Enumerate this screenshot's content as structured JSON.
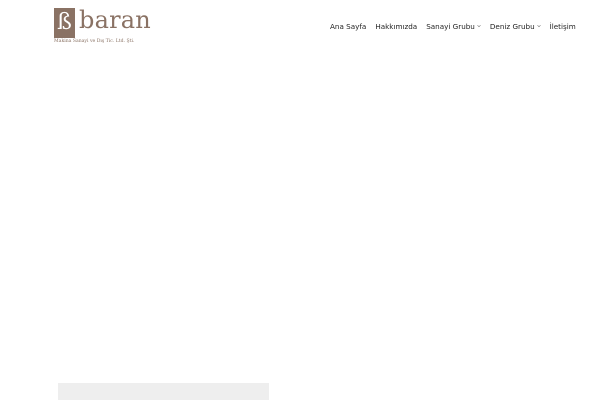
{
  "brand": {
    "mark": "ß",
    "name": "baran",
    "tagline": "Makina Sanayi ve Dış Tic. Ltd. Şti.",
    "color": "#8a7264"
  },
  "nav": {
    "items": [
      {
        "label": "Ana Sayfa"
      },
      {
        "label": "Hakkımızda"
      },
      {
        "label": "Sanayi Grubu",
        "icon": "chevron-down-icon"
      },
      {
        "label": "Deniz Grubu",
        "icon": "chevron-down-icon"
      },
      {
        "label": "İletişim"
      }
    ]
  }
}
